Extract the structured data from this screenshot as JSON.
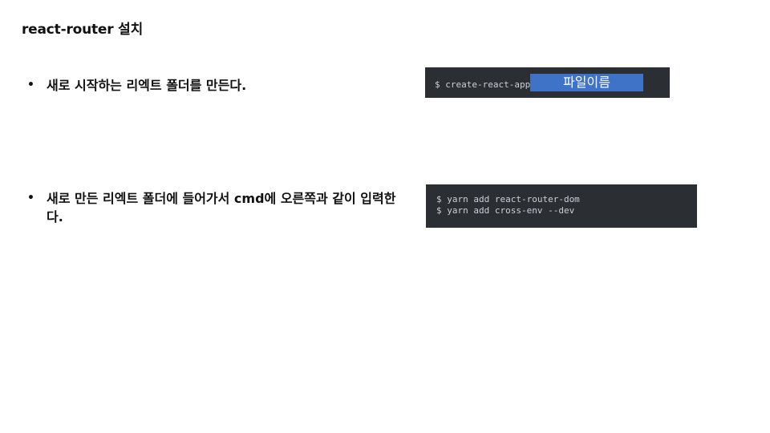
{
  "slide": {
    "title": "react-router 설치",
    "bullets": [
      {
        "marker": "•",
        "text": "새로 시작하는 리엑트 폴더를 만든다."
      },
      {
        "marker": "•",
        "text": "새로 만든 리엑트 폴더에 들어가서 cmd에 오른쪽과 같이 입력한다."
      }
    ]
  },
  "code_blocks": [
    {
      "command": "$ create-react-app",
      "placeholder": "파일이름"
    },
    {
      "lines": [
        "$ yarn add react-router-dom",
        "$ yarn add cross-env --dev"
      ]
    }
  ],
  "colors": {
    "code_background": "#2b2f34",
    "code_text": "#c9d1d9",
    "placeholder_highlight": "#3f73c7"
  }
}
